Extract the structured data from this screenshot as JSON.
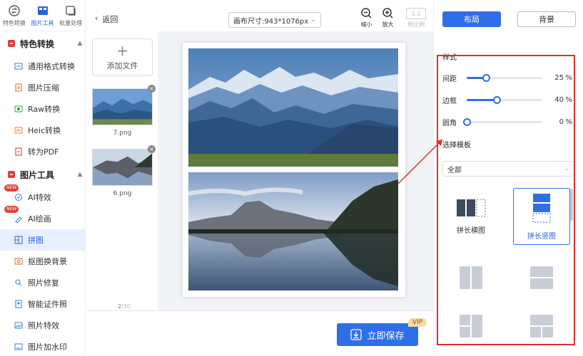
{
  "top_modes": [
    {
      "label": "特色转换"
    },
    {
      "label": "图片工具"
    },
    {
      "label": "批量处理"
    }
  ],
  "sidebar": {
    "group1": {
      "title": "特色转换"
    },
    "group1_items": [
      {
        "label": "通用格式转换"
      },
      {
        "label": "图片压缩"
      },
      {
        "label": "Raw转换"
      },
      {
        "label": "Heic转换"
      },
      {
        "label": "转为PDF"
      }
    ],
    "group2": {
      "title": "图片工具"
    },
    "group2_items": [
      {
        "label": "AI特效",
        "badge": "NEW"
      },
      {
        "label": "AI绘画",
        "badge": "NEW"
      },
      {
        "label": "拼图"
      },
      {
        "label": "抠图换背景"
      },
      {
        "label": "照片修复"
      },
      {
        "label": "智能证件照"
      },
      {
        "label": "照片特效"
      },
      {
        "label": "图片加水印"
      }
    ]
  },
  "toolbar": {
    "back_label": "返回",
    "canvas_size": "画布尺寸:943*1076px",
    "zoom_out_label": "缩小",
    "zoom_in_label": "放大",
    "ratio_button": "1:1",
    "original_label": "原比例"
  },
  "files": {
    "add_label": "添加文件",
    "items": [
      {
        "name": "7.png"
      },
      {
        "name": "6.png"
      }
    ],
    "page_current": "2",
    "page_total": "/30"
  },
  "save": {
    "label": "立即保存",
    "badge": "VIP"
  },
  "panel": {
    "tab_layout": "布局",
    "tab_background": "背景",
    "style_title": "样式",
    "sliders": [
      {
        "label": "间距",
        "value": 25,
        "unit": "%"
      },
      {
        "label": "边框",
        "value": 40,
        "unit": "%"
      },
      {
        "label": "圆角",
        "value": 0,
        "unit": "%"
      }
    ],
    "template_title": "选择模板",
    "template_filter": "全部",
    "templates": [
      {
        "label": "拼长横图"
      },
      {
        "label": "拼长竖图"
      }
    ]
  },
  "colors": {
    "accent": "#2f6fe6",
    "highlight_frame": "#e0302a"
  }
}
